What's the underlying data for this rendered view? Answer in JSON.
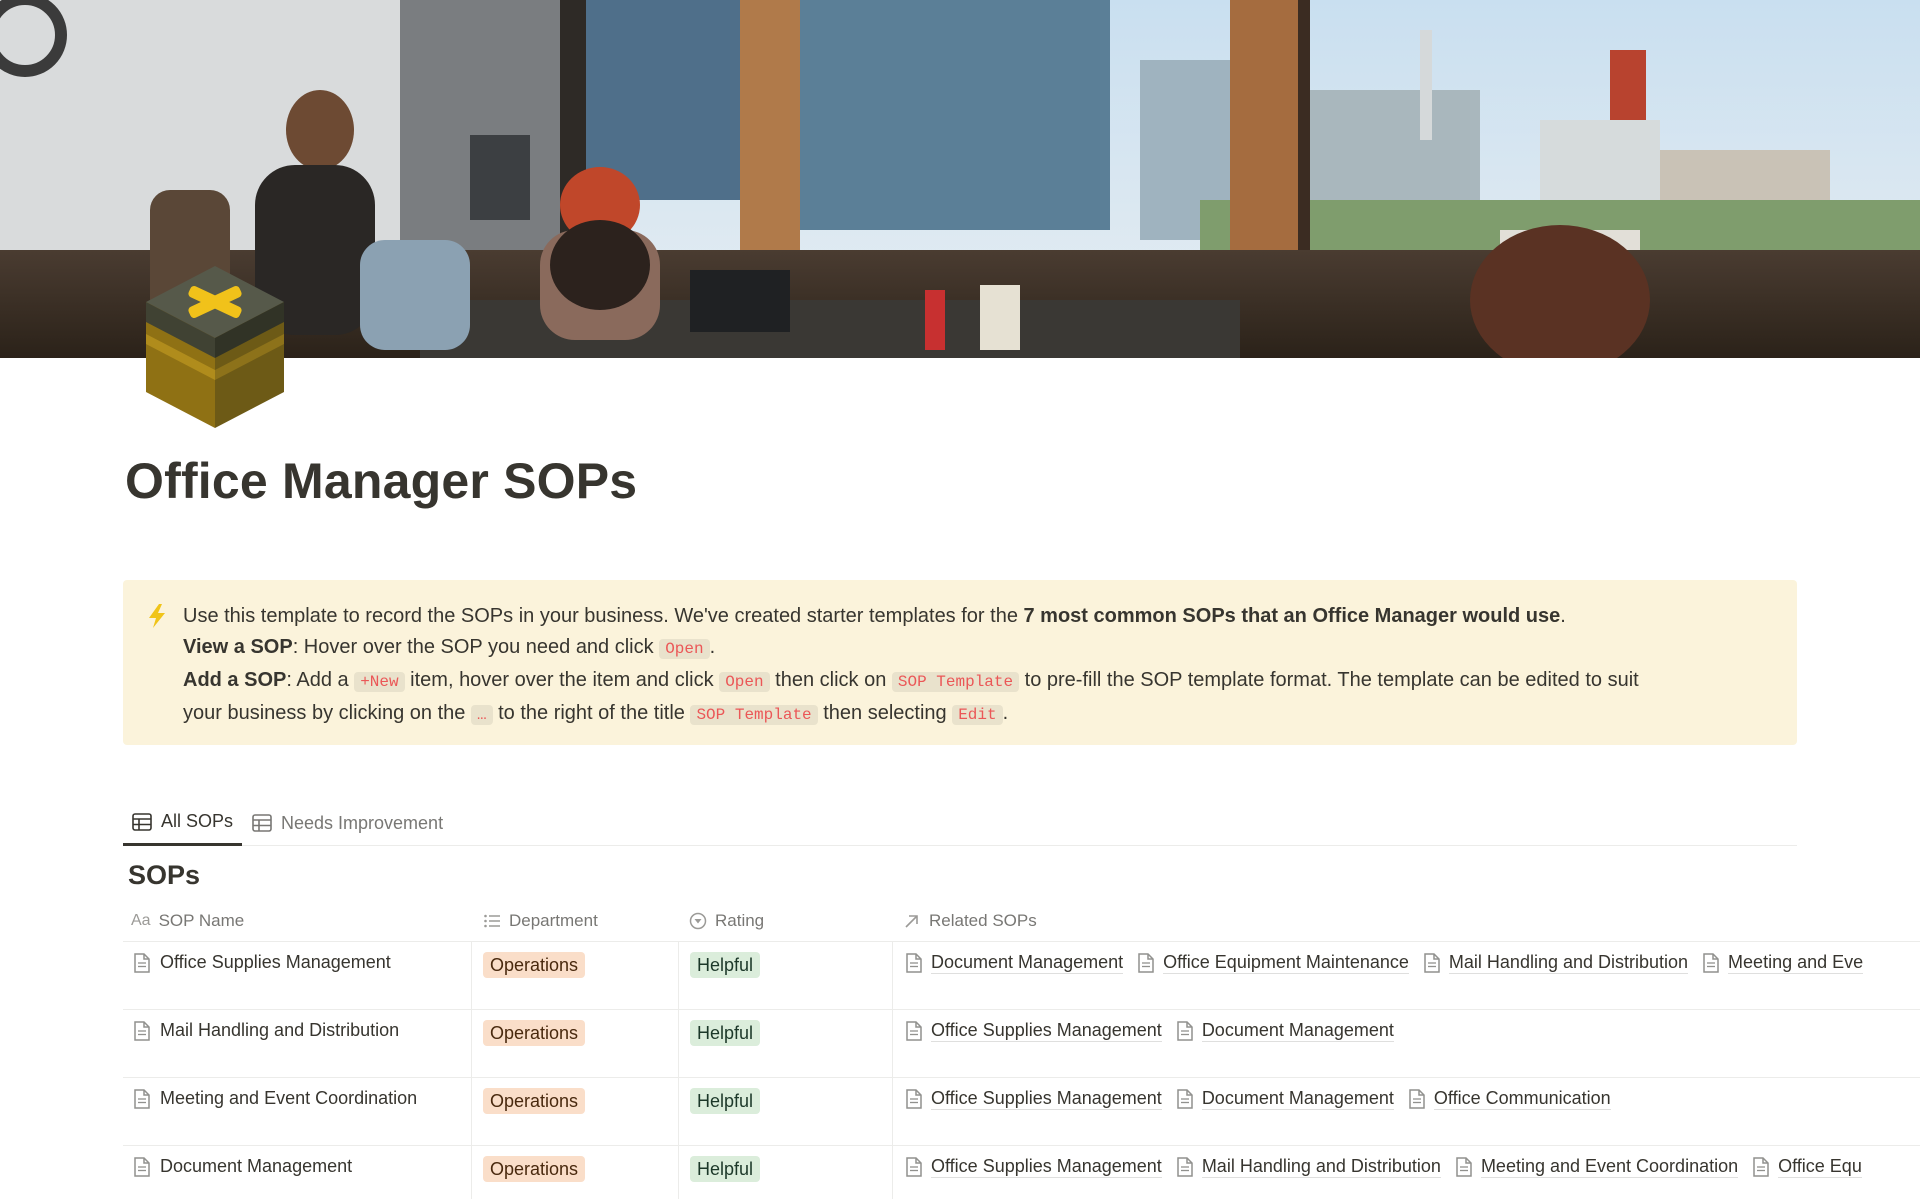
{
  "page": {
    "title": "Office Manager SOPs",
    "icon": "cube-x-icon"
  },
  "callout": {
    "icon": "lightning-icon",
    "line1_text": "Use this template to record the SOPs in your business. We've created starter templates for the ",
    "line1_bold": "7 most common SOPs that an Office Manager would use",
    "line1_end": ".",
    "line2_bold": "View a SOP",
    "line2_text": ": Hover over the SOP you need and click ",
    "line2_code": "Open",
    "line2_end": ".",
    "line3_bold": "Add a SOP",
    "line3_text1": ": Add a ",
    "line3_code1": "+New",
    "line3_text2": " item, hover over the item and click ",
    "line3_code2": "Open",
    "line3_text3": " then click on ",
    "line3_code3": "SOP Template",
    "line3_text4": " to pre-fill the SOP template format. The template can be edited to suit",
    "line4_text1": "your business by clicking on the ",
    "line4_code1": "…",
    "line4_text2": " to the right of the title ",
    "line4_code2": "SOP Template",
    "line4_text3": " then selecting ",
    "line4_code3": "Edit",
    "line4_end": "."
  },
  "tabs": [
    {
      "label": "All SOPs",
      "active": true
    },
    {
      "label": "Needs Improvement",
      "active": false
    }
  ],
  "database": {
    "title": "SOPs",
    "columns": {
      "name": "SOP Name",
      "department": "Department",
      "rating": "Rating",
      "related": "Related SOPs"
    },
    "rows": [
      {
        "name": "Office Supplies Management",
        "department": "Operations",
        "rating": "Helpful",
        "related": [
          "Document Management",
          "Office Equipment Maintenance",
          "Mail Handling and Distribution",
          "Meeting and Eve"
        ]
      },
      {
        "name": "Mail Handling and Distribution",
        "department": "Operations",
        "rating": "Helpful",
        "related": [
          "Office Supplies Management",
          "Document Management"
        ]
      },
      {
        "name": "Meeting and Event Coordination",
        "department": "Operations",
        "rating": "Helpful",
        "related": [
          "Office Supplies Management",
          "Document Management",
          "Office Communication"
        ]
      },
      {
        "name": "Document Management",
        "department": "Operations",
        "rating": "Helpful",
        "related": [
          "Office Supplies Management",
          "Mail Handling and Distribution",
          "Meeting and Event Coordination",
          "Office Equ"
        ]
      }
    ]
  },
  "colors": {
    "callout_bg": "#fbf3db",
    "code_text": "#eb5757",
    "tag_operations_bg": "#fadec9",
    "tag_helpful_bg": "#dbeddb"
  }
}
